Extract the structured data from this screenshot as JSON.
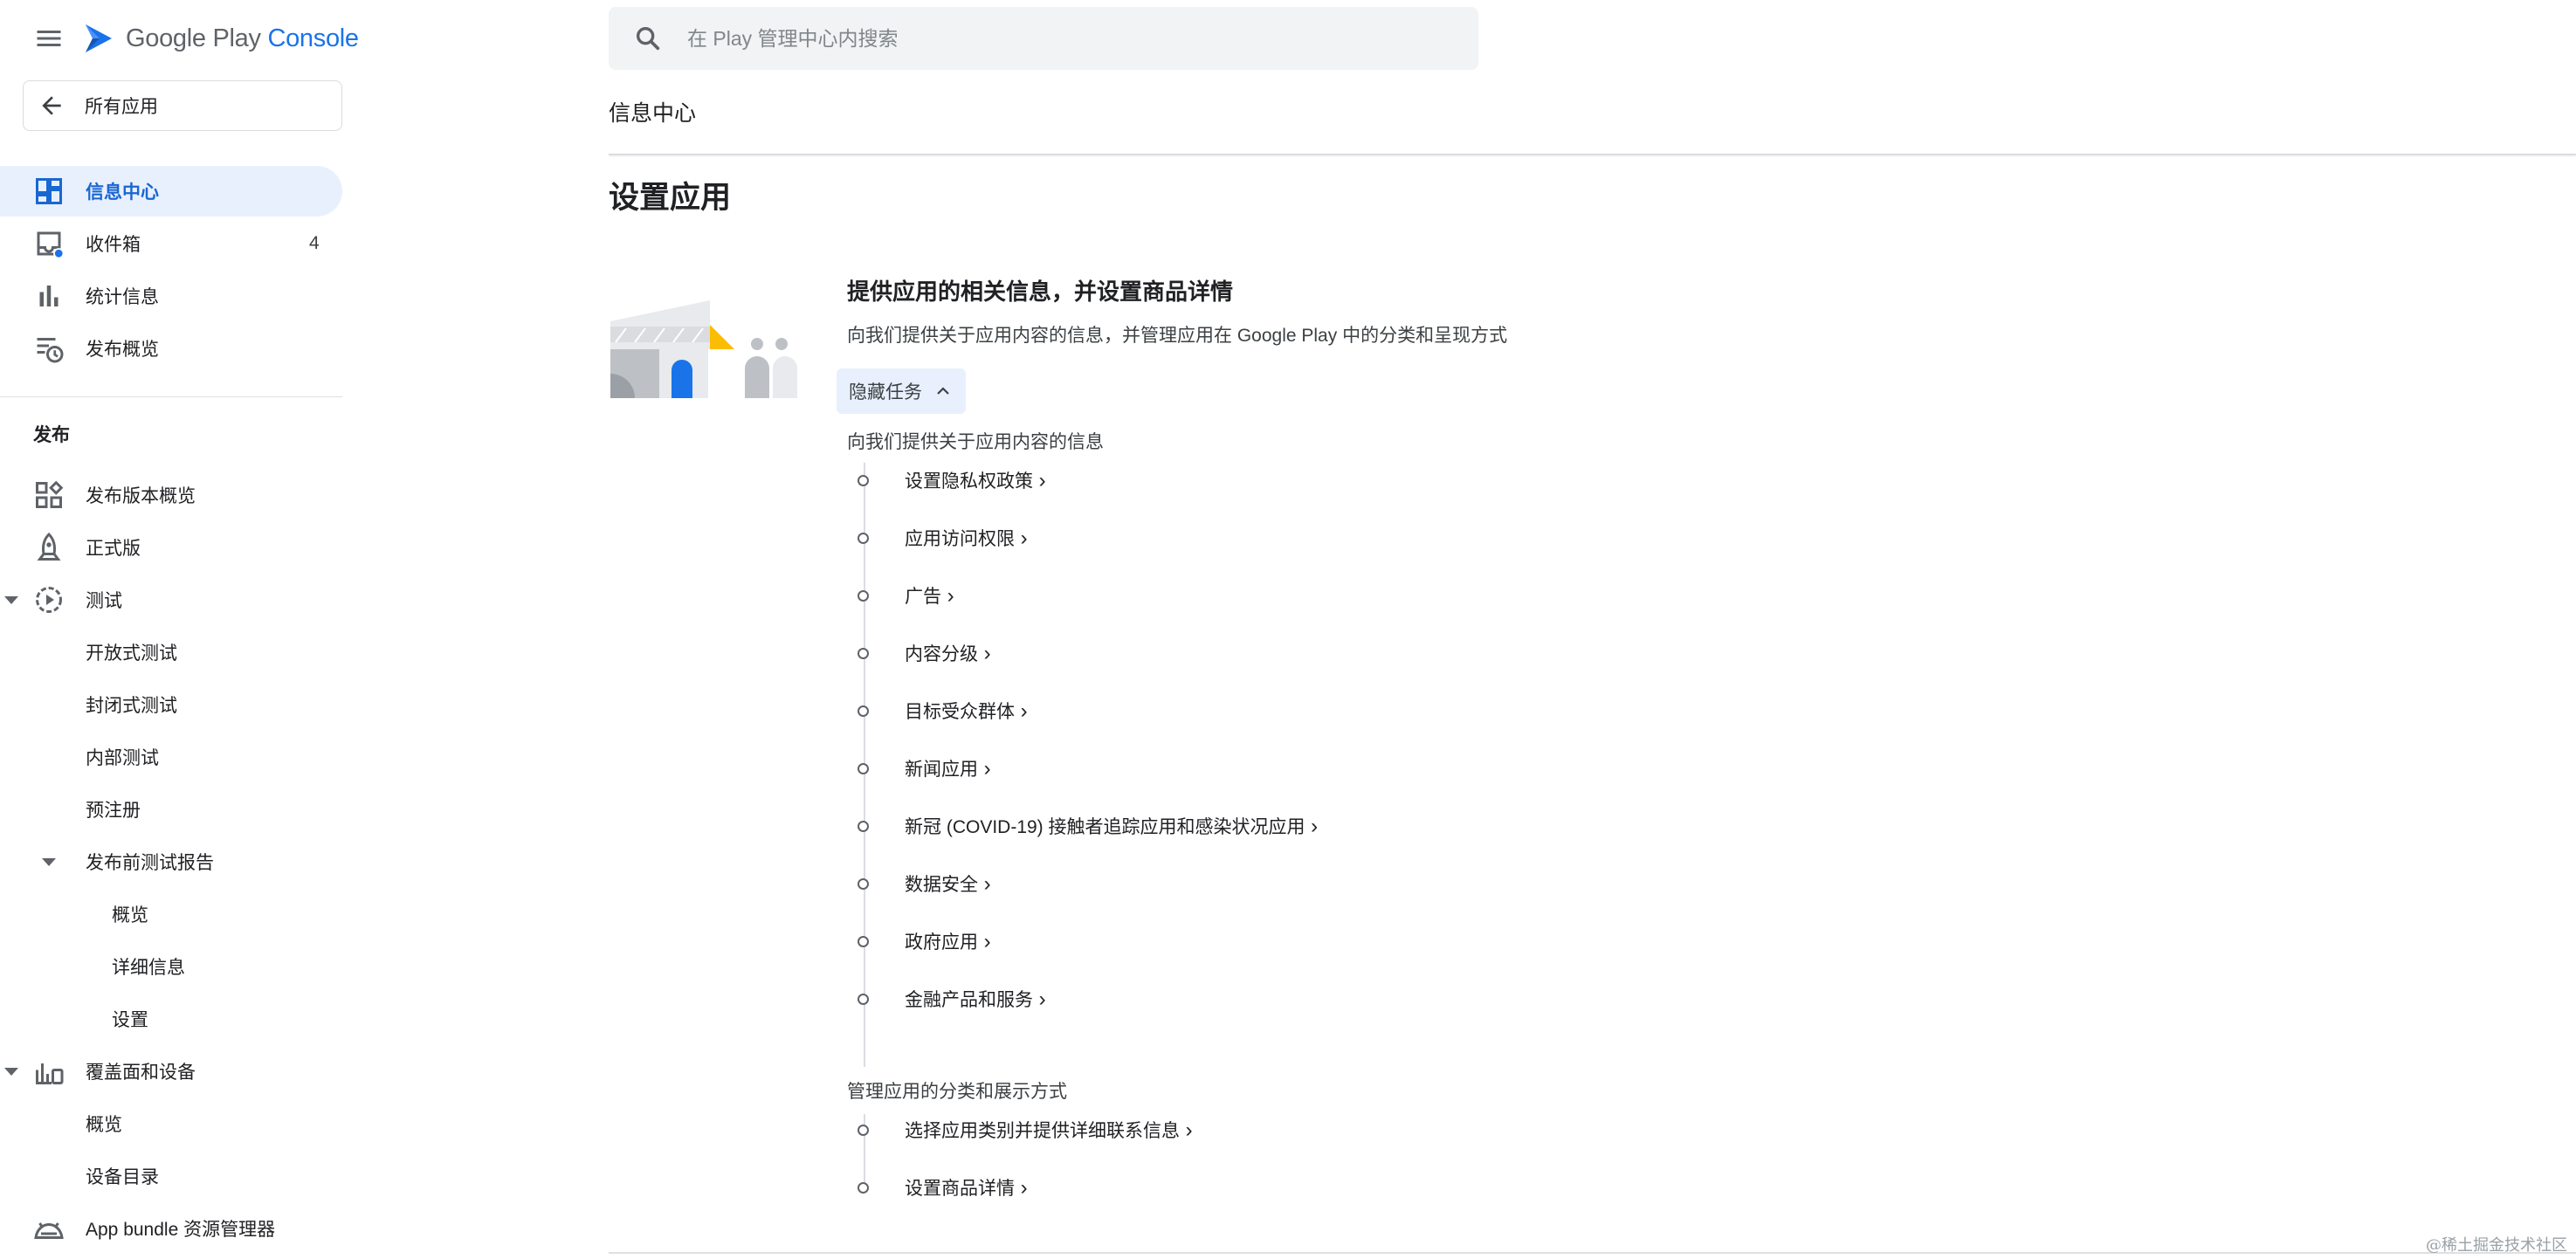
{
  "header": {
    "brand_google_play": "Google Play",
    "brand_console": "Console",
    "search_placeholder": "在 Play 管理中心内搜索"
  },
  "sidebar": {
    "all_apps_label": "所有应用",
    "items": [
      {
        "label": "信息中心",
        "icon": "dashboard-icon",
        "active": true
      },
      {
        "label": "收件箱",
        "icon": "inbox-icon",
        "count": "4"
      },
      {
        "label": "统计信息",
        "icon": "bar-chart-icon"
      },
      {
        "label": "发布概览",
        "icon": "publishing-overview-icon"
      }
    ],
    "release_section_label": "发布",
    "release_items": [
      {
        "label": "发布版本概览",
        "icon": "release-overview-icon"
      },
      {
        "label": "正式版",
        "icon": "production-icon"
      },
      {
        "label": "测试",
        "icon": "testing-icon"
      },
      {
        "label": "开放式测试"
      },
      {
        "label": "封闭式测试"
      },
      {
        "label": "内部测试"
      },
      {
        "label": "预注册"
      },
      {
        "label": "发布前测试报告"
      },
      {
        "label": "概览"
      },
      {
        "label": "详细信息"
      },
      {
        "label": "设置"
      },
      {
        "label": "覆盖面和设备",
        "icon": "reach-devices-icon"
      },
      {
        "label": "概览"
      },
      {
        "label": "设备目录"
      },
      {
        "label": "App bundle 资源管理器",
        "icon": "app-bundle-icon"
      }
    ]
  },
  "main": {
    "breadcrumb_title": "信息中心",
    "page_title": "设置应用",
    "card": {
      "title": "提供应用的相关信息，并设置商品详情",
      "subtitle": "向我们提供关于应用内容的信息，并管理应用在 Google Play 中的分类和呈现方式",
      "hide_tasks_label": "隐藏任务",
      "group1_label": "向我们提供关于应用内容的信息",
      "group1_tasks": [
        "设置隐私权政策",
        "应用访问权限",
        "广告",
        "内容分级",
        "目标受众群体",
        "新闻应用",
        "新冠 (COVID-19) 接触者追踪应用和感染状况应用",
        "数据安全",
        "政府应用",
        "金融产品和服务"
      ],
      "group2_label": "管理应用的分类和展示方式",
      "group2_tasks": [
        "选择应用类别并提供详细联系信息",
        "设置商品详情"
      ]
    }
  },
  "watermark": "@稀土掘金技术社区",
  "colors": {
    "accent": "#1a73e8",
    "active_bg": "#e8f0fe",
    "active_text": "#1967d2",
    "inbox_badge": "#1a73e8",
    "illustration_yellow": "#fbbc04"
  }
}
